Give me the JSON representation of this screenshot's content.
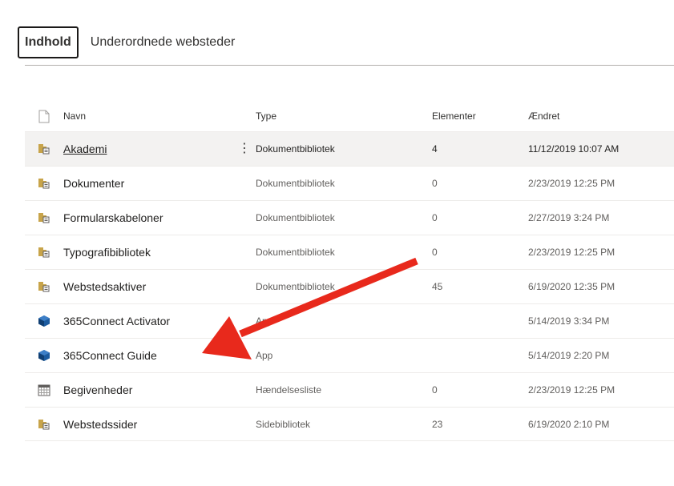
{
  "tabs": [
    {
      "label": "Indhold",
      "active": true
    },
    {
      "label": "Underordnede websteder",
      "active": false
    }
  ],
  "columns": {
    "name": "Navn",
    "type": "Type",
    "items": "Elementer",
    "modified": "Ændret"
  },
  "rows": [
    {
      "icon": "library-icon",
      "name": "Akademi",
      "type": "Dokumentbibliotek",
      "items": "4",
      "modified": "11/12/2019 10:07 AM",
      "selected": true
    },
    {
      "icon": "library-icon",
      "name": "Dokumenter",
      "type": "Dokumentbibliotek",
      "items": "0",
      "modified": "2/23/2019 12:25 PM"
    },
    {
      "icon": "library-icon",
      "name": "Formularskabeloner",
      "type": "Dokumentbibliotek",
      "items": "0",
      "modified": "2/27/2019 3:24 PM"
    },
    {
      "icon": "library-icon",
      "name": "Typografibibliotek",
      "type": "Dokumentbibliotek",
      "items": "0",
      "modified": "2/23/2019 12:25 PM"
    },
    {
      "icon": "library-icon",
      "name": "Webstedsaktiver",
      "type": "Dokumentbibliotek",
      "items": "45",
      "modified": "6/19/2020 12:35 PM"
    },
    {
      "icon": "app-icon",
      "name": "365Connect Activator",
      "type": "App",
      "items": "",
      "modified": "5/14/2019 3:34 PM"
    },
    {
      "icon": "app-icon",
      "name": "365Connect Guide",
      "type": "App",
      "items": "",
      "modified": "5/14/2019 2:20 PM"
    },
    {
      "icon": "calendar-icon",
      "name": "Begivenheder",
      "type": "Hændelsesliste",
      "items": "0",
      "modified": "2/23/2019 12:25 PM"
    },
    {
      "icon": "library-icon",
      "name": "Webstedssider",
      "type": "Sidebibliotek",
      "items": "23",
      "modified": "6/19/2020 2:10 PM"
    }
  ],
  "more_glyph": "⋮",
  "colors": {
    "arrow": "#e8291c",
    "library_icon": "#c8a44a",
    "app_icon": "#1c5b9f"
  }
}
